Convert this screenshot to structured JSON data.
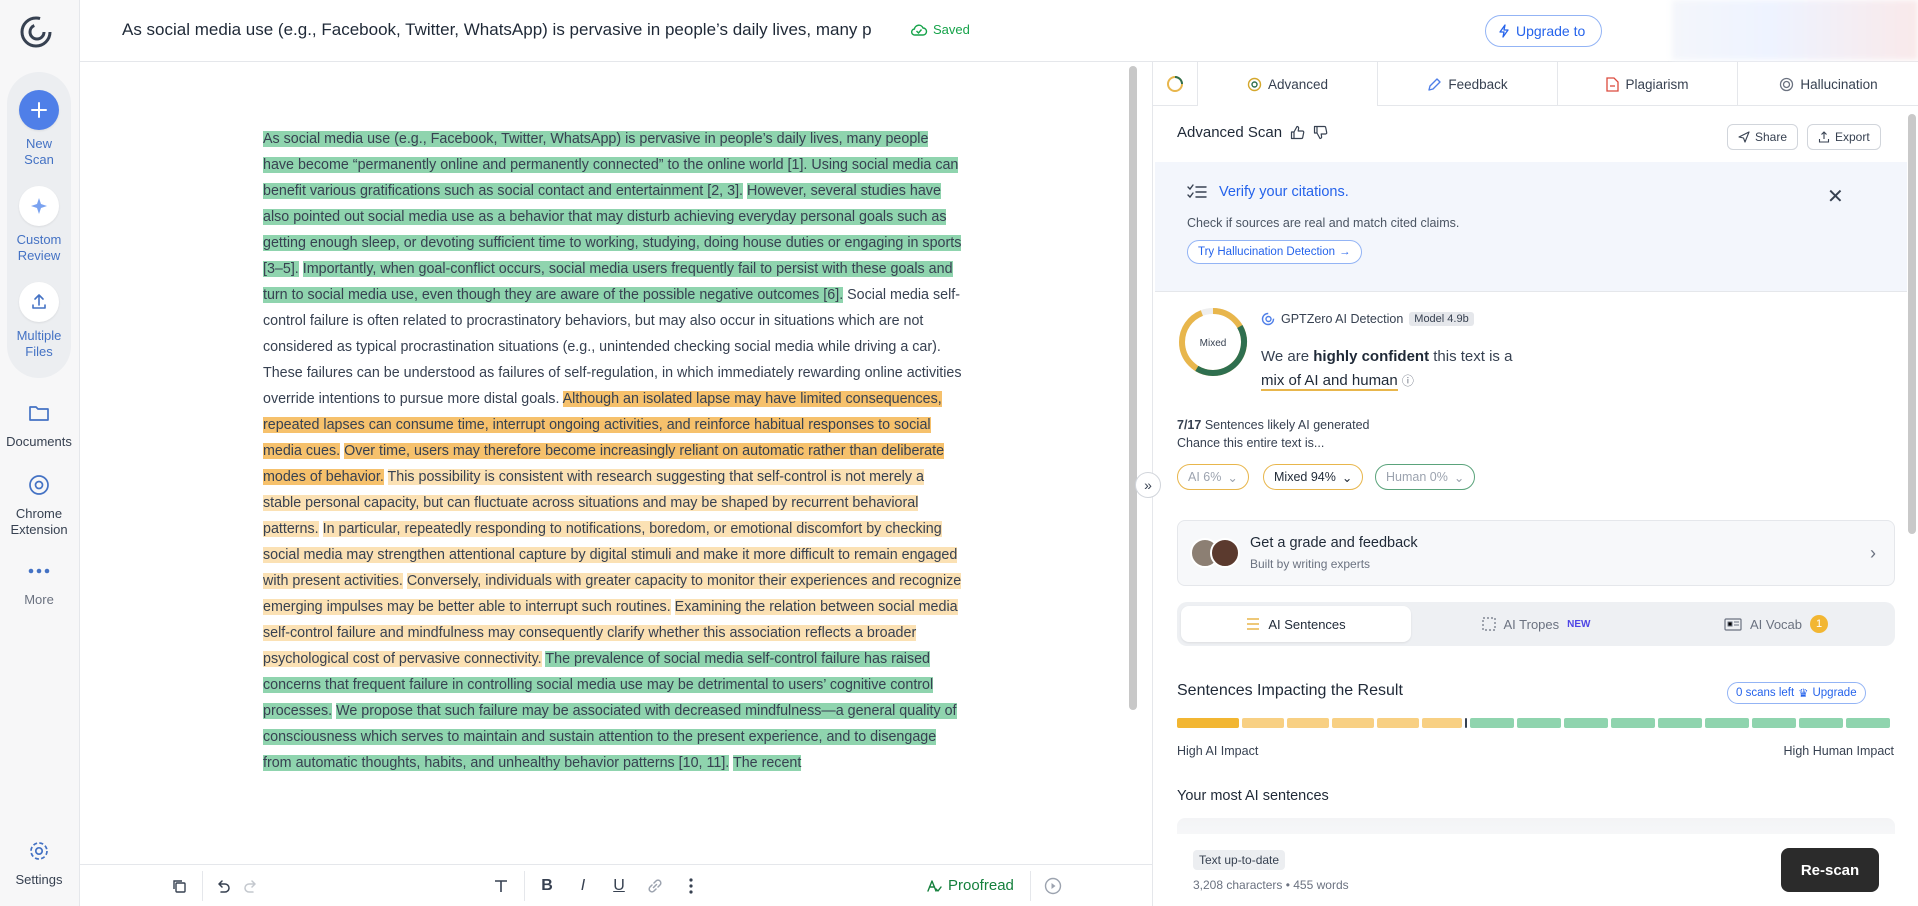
{
  "rail": {
    "new_scan": [
      "New",
      "Scan"
    ],
    "custom_review": [
      "Custom",
      "Review"
    ],
    "multiple_files": [
      "Multiple",
      "Files"
    ],
    "documents": "Documents",
    "chrome_extension": [
      "Chrome",
      "Extension"
    ],
    "more": "More",
    "settings": "Settings"
  },
  "header": {
    "title": "As social media use (e.g., Facebook, Twitter, WhatsApp) is pervasive in people’s daily lives, many p",
    "saved": "Saved",
    "upgrade": "Upgrade to"
  },
  "editor": {
    "segments": [
      {
        "h": "g",
        "t": "As social media use (e.g., Facebook, Twitter, WhatsApp) is pervasive in people’s daily lives, many people have become “permanently online and permanently connected” to the online world [1]. Using social media can benefit various gratifications such as social contact and entertainment [2, 3]."
      },
      {
        "h": "",
        "t": " "
      },
      {
        "h": "g",
        "t": "However, several studies have also pointed out social media use as a behavior that may disturb achieving everyday personal goals such as getting enough sleep, or devoting sufficient time to working, studying, doing house duties or engaging in sports [3–5]."
      },
      {
        "h": "",
        "t": " "
      },
      {
        "h": "g",
        "t": "Importantly, when goal-conflict occurs, social media users frequently fail to persist with these goals and turn to social media use, even though they are aware of the possible negative outcomes [6]."
      },
      {
        "h": "",
        "t": " Social media self-control failure is often related to procrastinatory behaviors, but may also occur in situations which are not considered as typical procrastination situations (e.g., unintended checking social media while driving a car). These failures can be understood as failures of self-regulation, in which immediately rewarding online activities override intentions to pursue more distal goals. "
      },
      {
        "h": "o",
        "t": "Although an isolated lapse may have limited consequences, repeated lapses can consume time, interrupt ongoing activities, and reinforce habitual responses to social media cues."
      },
      {
        "h": "",
        "t": " "
      },
      {
        "h": "o",
        "t": "Over time, users may therefore become increasingly reliant on automatic rather than deliberate modes of behavior."
      },
      {
        "h": "",
        "t": " "
      },
      {
        "h": "y",
        "t": "This possibility is consistent with research suggesting that self-control is not merely a stable personal capacity, but can fluctuate across situations and may be shaped by recurrent behavioral patterns."
      },
      {
        "h": "",
        "t": " "
      },
      {
        "h": "y",
        "t": "In particular, repeatedly responding to notifications, boredom, or emotional discomfort by checking social media may strengthen attentional capture by digital stimuli and make it more difficult to remain engaged with present activities."
      },
      {
        "h": "",
        "t": " "
      },
      {
        "h": "y",
        "t": "Conversely, individuals with greater capacity to monitor their experiences and recognize emerging impulses may be better able to interrupt such routines."
      },
      {
        "h": "",
        "t": " "
      },
      {
        "h": "y",
        "t": "Examining the relation between social media self-control failure and mindfulness may consequently clarify whether this association reflects a broader psychological cost of pervasive connectivity."
      },
      {
        "h": "",
        "t": " "
      },
      {
        "h": "g",
        "t": "The prevalence of social media self-control failure has raised concerns that frequent failure in controlling social media use may be detrimental to users’ cognitive control processes."
      },
      {
        "h": "",
        "t": " "
      },
      {
        "h": "g",
        "t": "We propose that such failure may be associated with decreased mindfulness—a general quality of consciousness which serves to maintain and sustain attention to the present experience, and to disengage from automatic thoughts, habits, and unhealthy behavior patterns [10, 11]."
      },
      {
        "h": "",
        "t": " "
      },
      {
        "h": "g",
        "t": "The recent"
      }
    ]
  },
  "toolbar": {
    "proofread": "Proofread"
  },
  "panel": {
    "tabs": [
      "Advanced",
      "Feedback",
      "Plagiarism",
      "Hallucination"
    ],
    "scan_title": "Advanced Scan",
    "share": "Share",
    "export": "Export",
    "citations": {
      "title": "Verify your citations.",
      "subtitle": "Check if sources are real and match cited claims.",
      "button": "Try Hallucination Detection"
    },
    "detection": {
      "donut_label": "Mixed",
      "product": "GPTZero AI Detection",
      "model": "Model 4.9b",
      "verdict_prefix": "We are ",
      "verdict_strong": "highly confident",
      "verdict_mid": " this text is a",
      "verdict_mix": "mix of AI and human",
      "fraction_bold": "7/17",
      "fraction_text": " Sentences likely AI generated",
      "chance": "Chance this entire text is...",
      "pill_ai": "AI 6%",
      "pill_mixed": "Mixed 94%",
      "pill_human": "Human 0%",
      "ai_pct": 6,
      "mixed_pct": 94,
      "human_pct": 0
    },
    "grade": {
      "title": "Get a grade and feedback",
      "subtitle": "Built by writing experts"
    },
    "seg": {
      "sentences": "AI Sentences",
      "tropes": "AI Tropes",
      "tropes_tag": "NEW",
      "vocab": "AI Vocab",
      "vocab_count": "1"
    },
    "impact": {
      "title": "Sentences Impacting the Result",
      "scans_left": "0 scans left",
      "upgrade": "Upgrade",
      "left_label": "High AI Impact",
      "right_label": "High Human Impact"
    },
    "most_ai": "Your most AI sentences",
    "status": {
      "uptodate": "Text up-to-date",
      "counts": "3,208 characters • 455 words"
    },
    "rescan": "Re-scan"
  },
  "colors": {
    "ai_green": "#8fd4ae",
    "mixed_orange": "#f6c16c",
    "mixed_light": "#fbe1b4",
    "accent_blue": "#2563eb",
    "mixed_ring": "#e8b64c",
    "human_ring": "#2f6f4f"
  }
}
